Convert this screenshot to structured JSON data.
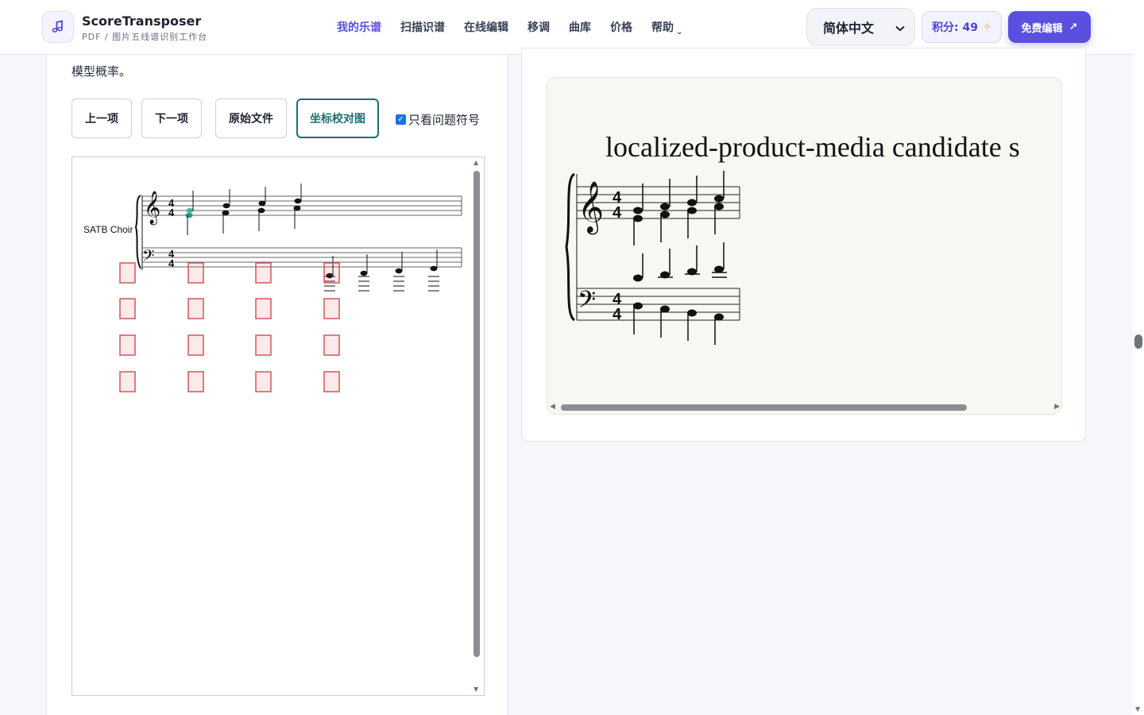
{
  "header": {
    "brand_name": "ScoreTransposer",
    "brand_sub": "PDF / 图片五线谱识别工作台",
    "logo_icon": "music-note-icon",
    "nav": [
      {
        "label": "我的乐谱",
        "active": true
      },
      {
        "label": "扫描识谱",
        "active": false
      },
      {
        "label": "在线编辑",
        "active": false
      },
      {
        "label": "移调",
        "active": false
      },
      {
        "label": "曲库",
        "active": false
      },
      {
        "label": "价格",
        "active": false
      },
      {
        "label": "帮助",
        "active": false
      }
    ],
    "language": "简体中文",
    "credits": "积分: 49",
    "free_edit": "免费编辑",
    "accent": "#5b4fe0"
  },
  "left": {
    "prob_text": "模型概率。",
    "buttons": {
      "prev": "上一项",
      "next": "下一项",
      "original": "原始文件",
      "overlay": "坐标校对图"
    },
    "only_issues": {
      "label": "只看问题符号",
      "checked": true
    },
    "score": {
      "part_name": "SATB Choir",
      "time_signature": "4/4"
    }
  },
  "right": {
    "preview_title": "localized-product-media candidate s"
  }
}
